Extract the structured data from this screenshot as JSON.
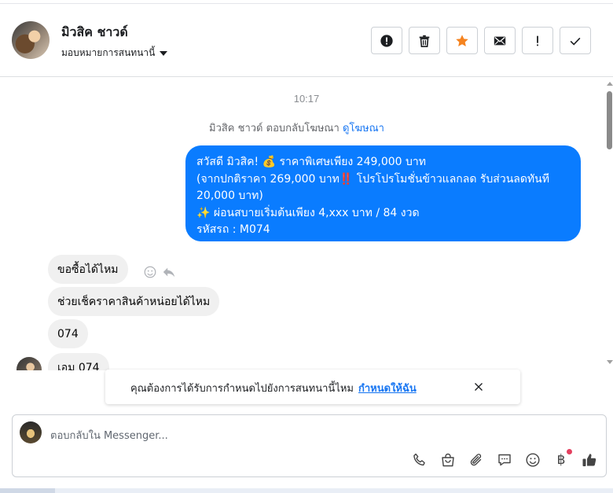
{
  "header": {
    "contact_name": "มิวสิค ชาวด์",
    "assign_label": "มอบหมายการสนทนานี้",
    "actions": [
      {
        "name": "report-spam",
        "icon": "alert-circle-icon"
      },
      {
        "name": "delete",
        "icon": "trash-icon"
      },
      {
        "name": "star",
        "icon": "star-icon"
      },
      {
        "name": "mark-unread",
        "icon": "envelope-icon"
      },
      {
        "name": "mark-important",
        "icon": "exclamation-icon"
      },
      {
        "name": "mark-done",
        "icon": "check-icon"
      }
    ],
    "star_color": "#f5831f"
  },
  "conversation": {
    "time": "10:17",
    "reply_note": "มิวสิค ชาวด์ ตอบกลับโฆษณา",
    "reply_note_link": "ดูโฆษณา",
    "outgoing": {
      "line1": "สวัสดี มิวสิค! 💰 ราคาพิเศษเพียง 249,000 บาท",
      "line2": "(จากปกติราคา 269,000 บาท‼️ โปรโปรโมชั่นข้าวแลกลด รับส่วนลดทันที",
      "line3": "20,000 บาท)",
      "line4": "✨ ผ่อนสบายเริ่มต้นเพียง 4,xxx บาท / 84 งวด",
      "line5": " รหัสรถ : M074",
      "color": "#0a7cff"
    },
    "incoming": [
      "ขอซื้อได้ไหม",
      "ช่วยเช็คราคาสินค้าหน่อยได้ไหม",
      "074",
      "เอม 074"
    ]
  },
  "toast": {
    "text": "คุณต้องการได้รับการกำหนดไปยังการสนทนานี้ไหม",
    "link": "กำหนดให้ฉัน"
  },
  "composer": {
    "placeholder": "ตอบกลับใน Messenger...",
    "tools": [
      "phone-icon",
      "shopping-bag-icon",
      "paperclip-icon",
      "chat-bubble-icon",
      "smiley-icon",
      "baht-icon",
      "thumbs-up-icon"
    ],
    "baht_symbol": "฿"
  }
}
